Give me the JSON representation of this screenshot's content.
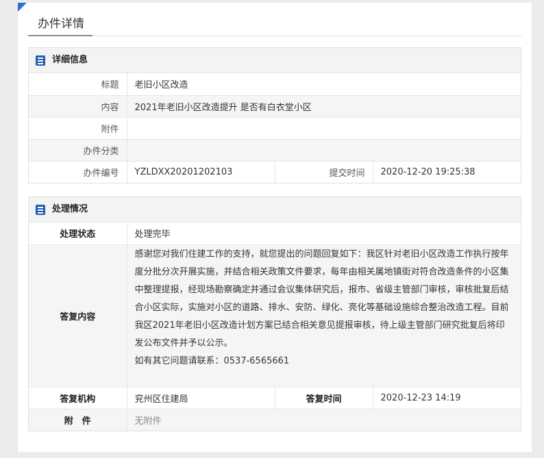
{
  "page": {
    "title": "办件详情"
  },
  "detail": {
    "heading": "详细信息",
    "rows": {
      "title_label": "标题",
      "title_value": "老旧小区改造",
      "content_label": "内容",
      "content_value": "2021年老旧小区改造提升 是否有白衣堂小区",
      "attachment_label": "附件",
      "attachment_value": "",
      "category_label": "办件分类",
      "category_value": "",
      "number_label": "办件编号",
      "number_value": "YZLDXX20201202103",
      "submit_time_label": "提交时间",
      "submit_time_value": "2020-12-20 19:25:38"
    }
  },
  "handling": {
    "heading": "处理情况",
    "status_label": "处理状态",
    "status_value": "处理完毕",
    "reply_label": "答复内容",
    "reply_text": "感谢您对我们住建工作的支持，就您提出的问题回复如下：我区针对老旧小区改造工作执行按年度分批分次开展实施，并结合相关政策文件要求，每年由相关属地镇街对符合改造条件的小区集中整理提报，经现场勘察确定并通过会议集体研究后，报市、省级主管部门审核，审核批复后结合小区实际，实施对小区的道路、排水、安防、绿化、亮化等基础设施综合整治改造工程。目前我区2021年老旧小区改造计划方案已结合相关意见提报审核，待上级主管部门研究批复后将印发公布文件并予以公示。",
    "reply_contact": "如有其它问题请联系：0537-6565661",
    "org_label": "答复机构",
    "org_value": "兖州区住建局",
    "reply_time_label": "答复时间",
    "reply_time_value": "2020-12-23 14:19",
    "attachment_label": "附　件",
    "attachment_value": "无附件"
  },
  "colors": {
    "accent": "#2f6fd6",
    "icon": "#1e5fb3",
    "row_alt": "#f5f5f5"
  },
  "icons": {
    "panel": "document-list-icon",
    "corner": "corner-triangle-icon"
  }
}
